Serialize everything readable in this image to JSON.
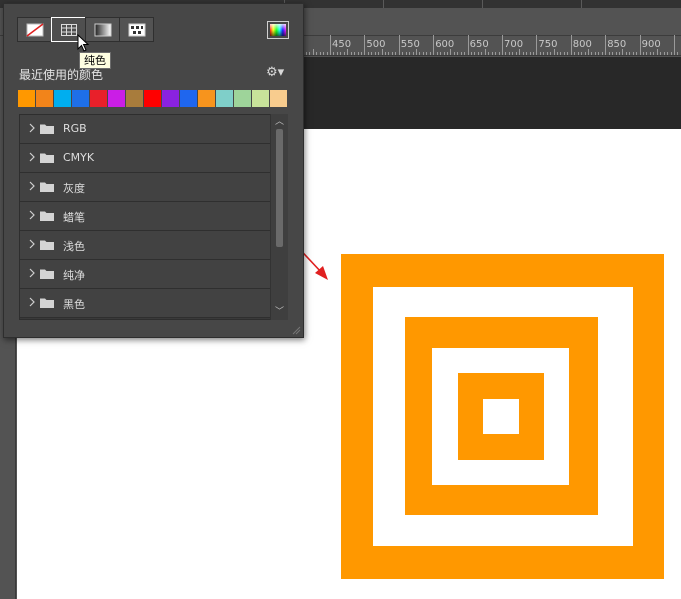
{
  "ruler": {
    "labels": [
      "450",
      "500",
      "550",
      "600",
      "650",
      "700",
      "750",
      "800",
      "850",
      "900"
    ]
  },
  "panel": {
    "fill_types": [
      {
        "name": "none",
        "icon": "no-color-icon"
      },
      {
        "name": "solid",
        "icon": "solid-color-icon"
      },
      {
        "name": "gradient",
        "icon": "gradient-icon"
      },
      {
        "name": "pattern",
        "icon": "pattern-icon"
      }
    ],
    "tooltip": "纯色",
    "recent_label": "最近使用的颜色",
    "settings_icon": "gear-icon",
    "recent_colors": [
      "#ff9800",
      "#f2841a",
      "#00aeef",
      "#1e6fe8",
      "#e8202a",
      "#ca1ee6",
      "#a87c3c",
      "#ff0000",
      "#8a22e0",
      "#1f66ee",
      "#f7941d",
      "#7fcfc9",
      "#9ed49a",
      "#c8e39a",
      "#f8cc8e"
    ],
    "groups": [
      {
        "label": "RGB"
      },
      {
        "label": "CMYK"
      },
      {
        "label": "灰度"
      },
      {
        "label": "蜡笔"
      },
      {
        "label": "浅色"
      },
      {
        "label": "纯净"
      },
      {
        "label": "黑色"
      }
    ]
  },
  "canvas": {
    "artwork_color": "#ff9800",
    "background_color": "#ffffff"
  },
  "annotation": {
    "arrow_color": "#e02020"
  }
}
